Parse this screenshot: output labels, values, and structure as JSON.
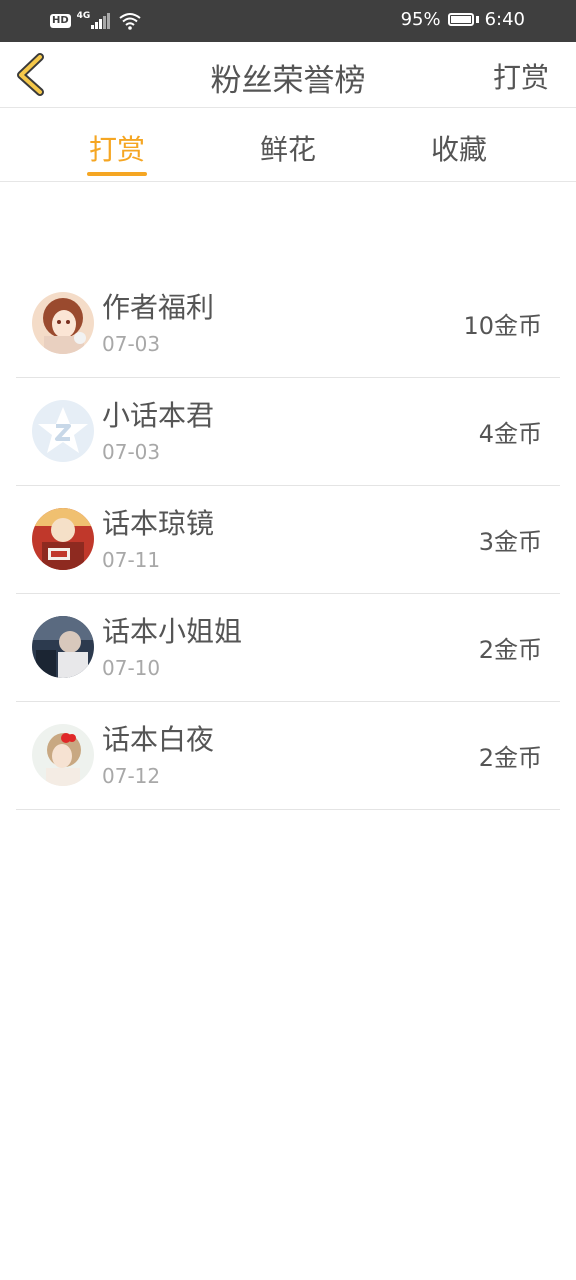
{
  "status_bar": {
    "hd": "HD",
    "network": "4G",
    "battery_percent": "95%",
    "battery_level": 0.95,
    "time": "6:40"
  },
  "nav": {
    "back_icon": "chevron-left-icon",
    "title": "粉丝荣誉榜",
    "action": "打赏"
  },
  "tabs": [
    {
      "label": "打赏",
      "active": true
    },
    {
      "label": "鲜花",
      "active": false
    },
    {
      "label": "收藏",
      "active": false
    }
  ],
  "accent_color": "#f5a623",
  "fans": [
    {
      "name": "作者福利",
      "date": "07-03",
      "amount": "10金币"
    },
    {
      "name": "小话本君",
      "date": "07-03",
      "amount": "4金币"
    },
    {
      "name": "话本琼镜",
      "date": "07-11",
      "amount": "3金币"
    },
    {
      "name": "话本小姐姐",
      "date": "07-10",
      "amount": "2金币"
    },
    {
      "name": "话本白夜",
      "date": "07-12",
      "amount": "2金币"
    }
  ]
}
